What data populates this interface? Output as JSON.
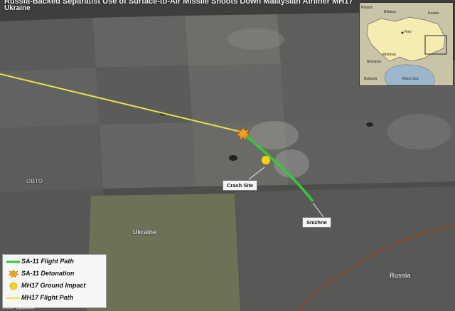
{
  "header": {
    "title": "Russia-Backed Separatist Use of Surface-to-Air Missile Shoots Down Malaysian Airliner MH17",
    "subtitle": "Ukraine"
  },
  "map": {
    "labels": {
      "crash_site": "Crash Site",
      "snizhne": "Snizhne",
      "ukraine": "Ukraine",
      "russia": "Russia",
      "stray_text": "OBTO"
    },
    "colors": {
      "sa11_path": "#35c93a",
      "mh17_path": "#e9e24a",
      "detonation": "#f0a020",
      "ground_impact": "#f4d31c",
      "border": "#8a4a2a"
    }
  },
  "inset": {
    "labels": [
      "Poland",
      "Belarus",
      "Russia",
      "Kiev",
      "Romania",
      "Moldova",
      "Bulgaria",
      "Black Sea"
    ]
  },
  "legend": {
    "items": [
      {
        "label": "SA-11 Flight Path",
        "symbol": "green-line"
      },
      {
        "label": "SA-11 Detonation",
        "symbol": "explosion-icon"
      },
      {
        "label": "MH17 Ground Impact",
        "symbol": "impact-icon"
      },
      {
        "label": "MH17 Flight Path",
        "symbol": "yellow-line"
      }
    ]
  },
  "credit": "© 2014 DigitalGlobe"
}
